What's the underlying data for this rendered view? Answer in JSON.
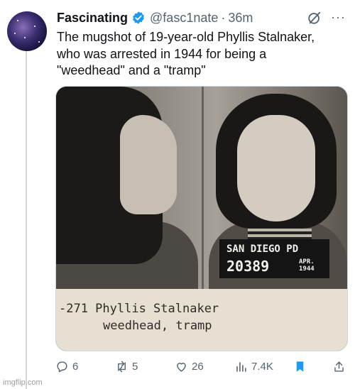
{
  "tweet": {
    "author_name": "Fascinating",
    "handle": "@fasc1nate",
    "separator": "·",
    "time": "36m",
    "text_lines": [
      "The mugshot of 19-year-old Phyllis Stalnaker,",
      "who was arrested in 1944 for being a",
      "\"weedhead\" and a \"tramp\""
    ],
    "more_label": "···"
  },
  "photo": {
    "placard_line1": "SAN DIEGO  PD",
    "placard_number": "20389",
    "placard_month": "APR.",
    "placard_year": "1944",
    "strip_line1": "-271  Phyllis Stalnaker",
    "strip_line2": "weedhead, tramp"
  },
  "actions": {
    "replies": "6",
    "reposts": "5",
    "likes": "26",
    "views": "7.4K"
  },
  "icons": {
    "verified": "verified-badge-icon",
    "grok": "grok-icon",
    "more": "more-icon",
    "reply": "reply-icon",
    "repost": "repost-icon",
    "like": "heart-icon",
    "views": "views-icon",
    "bookmark": "bookmark-icon",
    "share": "share-icon"
  },
  "colors": {
    "verified": "#1d9bf0",
    "bookmark": "#1d9bf0",
    "secondary_text": "#536471"
  },
  "watermark": "imgflip.com"
}
